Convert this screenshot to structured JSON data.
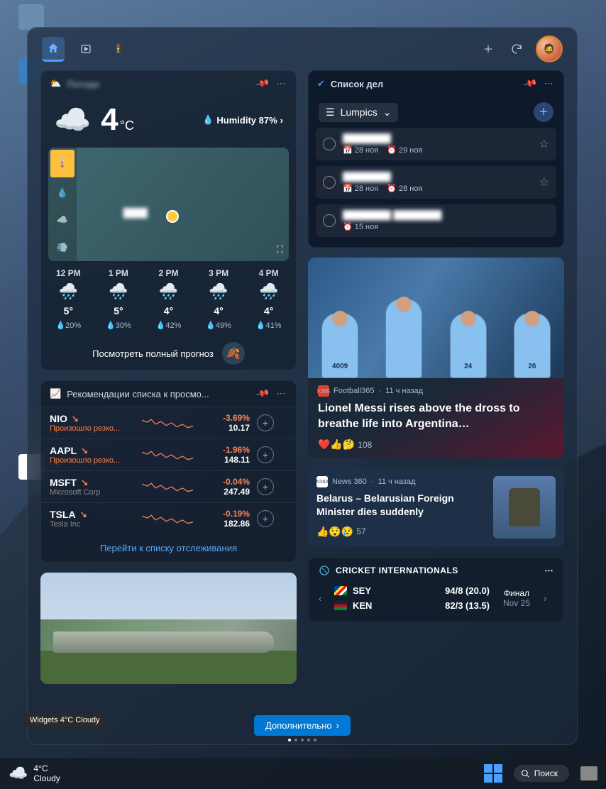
{
  "header": {
    "nav": [
      "home",
      "watch",
      "traffic"
    ]
  },
  "weather": {
    "title": "Погода",
    "temp": "4",
    "unit": "°C",
    "humidity_label": "Humidity 87%",
    "forecast": [
      {
        "time": "12 PM",
        "icon": "🌧️",
        "temp": "5°",
        "prec": "20%"
      },
      {
        "time": "1 PM",
        "icon": "🌧️",
        "temp": "5°",
        "prec": "30%"
      },
      {
        "time": "2 PM",
        "icon": "🌧️",
        "temp": "4°",
        "prec": "42%"
      },
      {
        "time": "3 PM",
        "icon": "🌧️",
        "temp": "4°",
        "prec": "49%"
      },
      {
        "time": "4 PM",
        "icon": "🌧️",
        "temp": "4°",
        "prec": "41%"
      }
    ],
    "footer": "Посмотреть полный прогноз"
  },
  "stocks": {
    "title": "Рекомендации списка к просмо...",
    "rows": [
      {
        "sym": "NIO",
        "sub": "Произошло резко...",
        "warn": true,
        "pct": "-3.69%",
        "price": "10.17"
      },
      {
        "sym": "AAPL",
        "sub": "Произошло резко...",
        "warn": true,
        "pct": "-1.96%",
        "price": "148.11"
      },
      {
        "sym": "MSFT",
        "sub": "Microsoft Corp",
        "warn": false,
        "pct": "-0.04%",
        "price": "247.49"
      },
      {
        "sym": "TSLA",
        "sub": "Tesla Inc",
        "warn": false,
        "pct": "-0.19%",
        "price": "182.86"
      }
    ],
    "footer": "Перейти к списку отслеживания"
  },
  "todo": {
    "title": "Список дел",
    "list_name": "Lumpics",
    "tasks": [
      {
        "title": "████████",
        "date1": "28 ноя",
        "date2": "29 ноя",
        "star": true
      },
      {
        "title": "████████",
        "date1": "28 ноя",
        "date2": "28 ноя",
        "star": true
      },
      {
        "title": "████████ ████████",
        "date1": "15 ноя",
        "date2": "",
        "star": false
      }
    ]
  },
  "news1": {
    "source": "Football365",
    "ago": "11 ч назад",
    "title": "Lionel Messi rises above the dross to breathe life into Argentina…",
    "reacts": "108",
    "jerseys": [
      "4009",
      "",
      "24",
      "26"
    ]
  },
  "news2": {
    "source": "News 360",
    "ago": "11 ч назад",
    "title": "Belarus – Belarusian Foreign Minister dies suddenly",
    "reacts": "57"
  },
  "cricket": {
    "title": "CRICKET INTERNATIONALS",
    "team1": {
      "code": "SEY",
      "score": "94/8 (20.0)"
    },
    "team2": {
      "code": "KEN",
      "score": "82/3 (13.5)"
    },
    "status": "Финал",
    "date": "Nov 25"
  },
  "more_button": "Дополнительно",
  "tooltip": "Widgets 4°C Cloudy",
  "taskbar": {
    "temp": "4°C",
    "cond": "Cloudy",
    "search": "Поиск"
  }
}
